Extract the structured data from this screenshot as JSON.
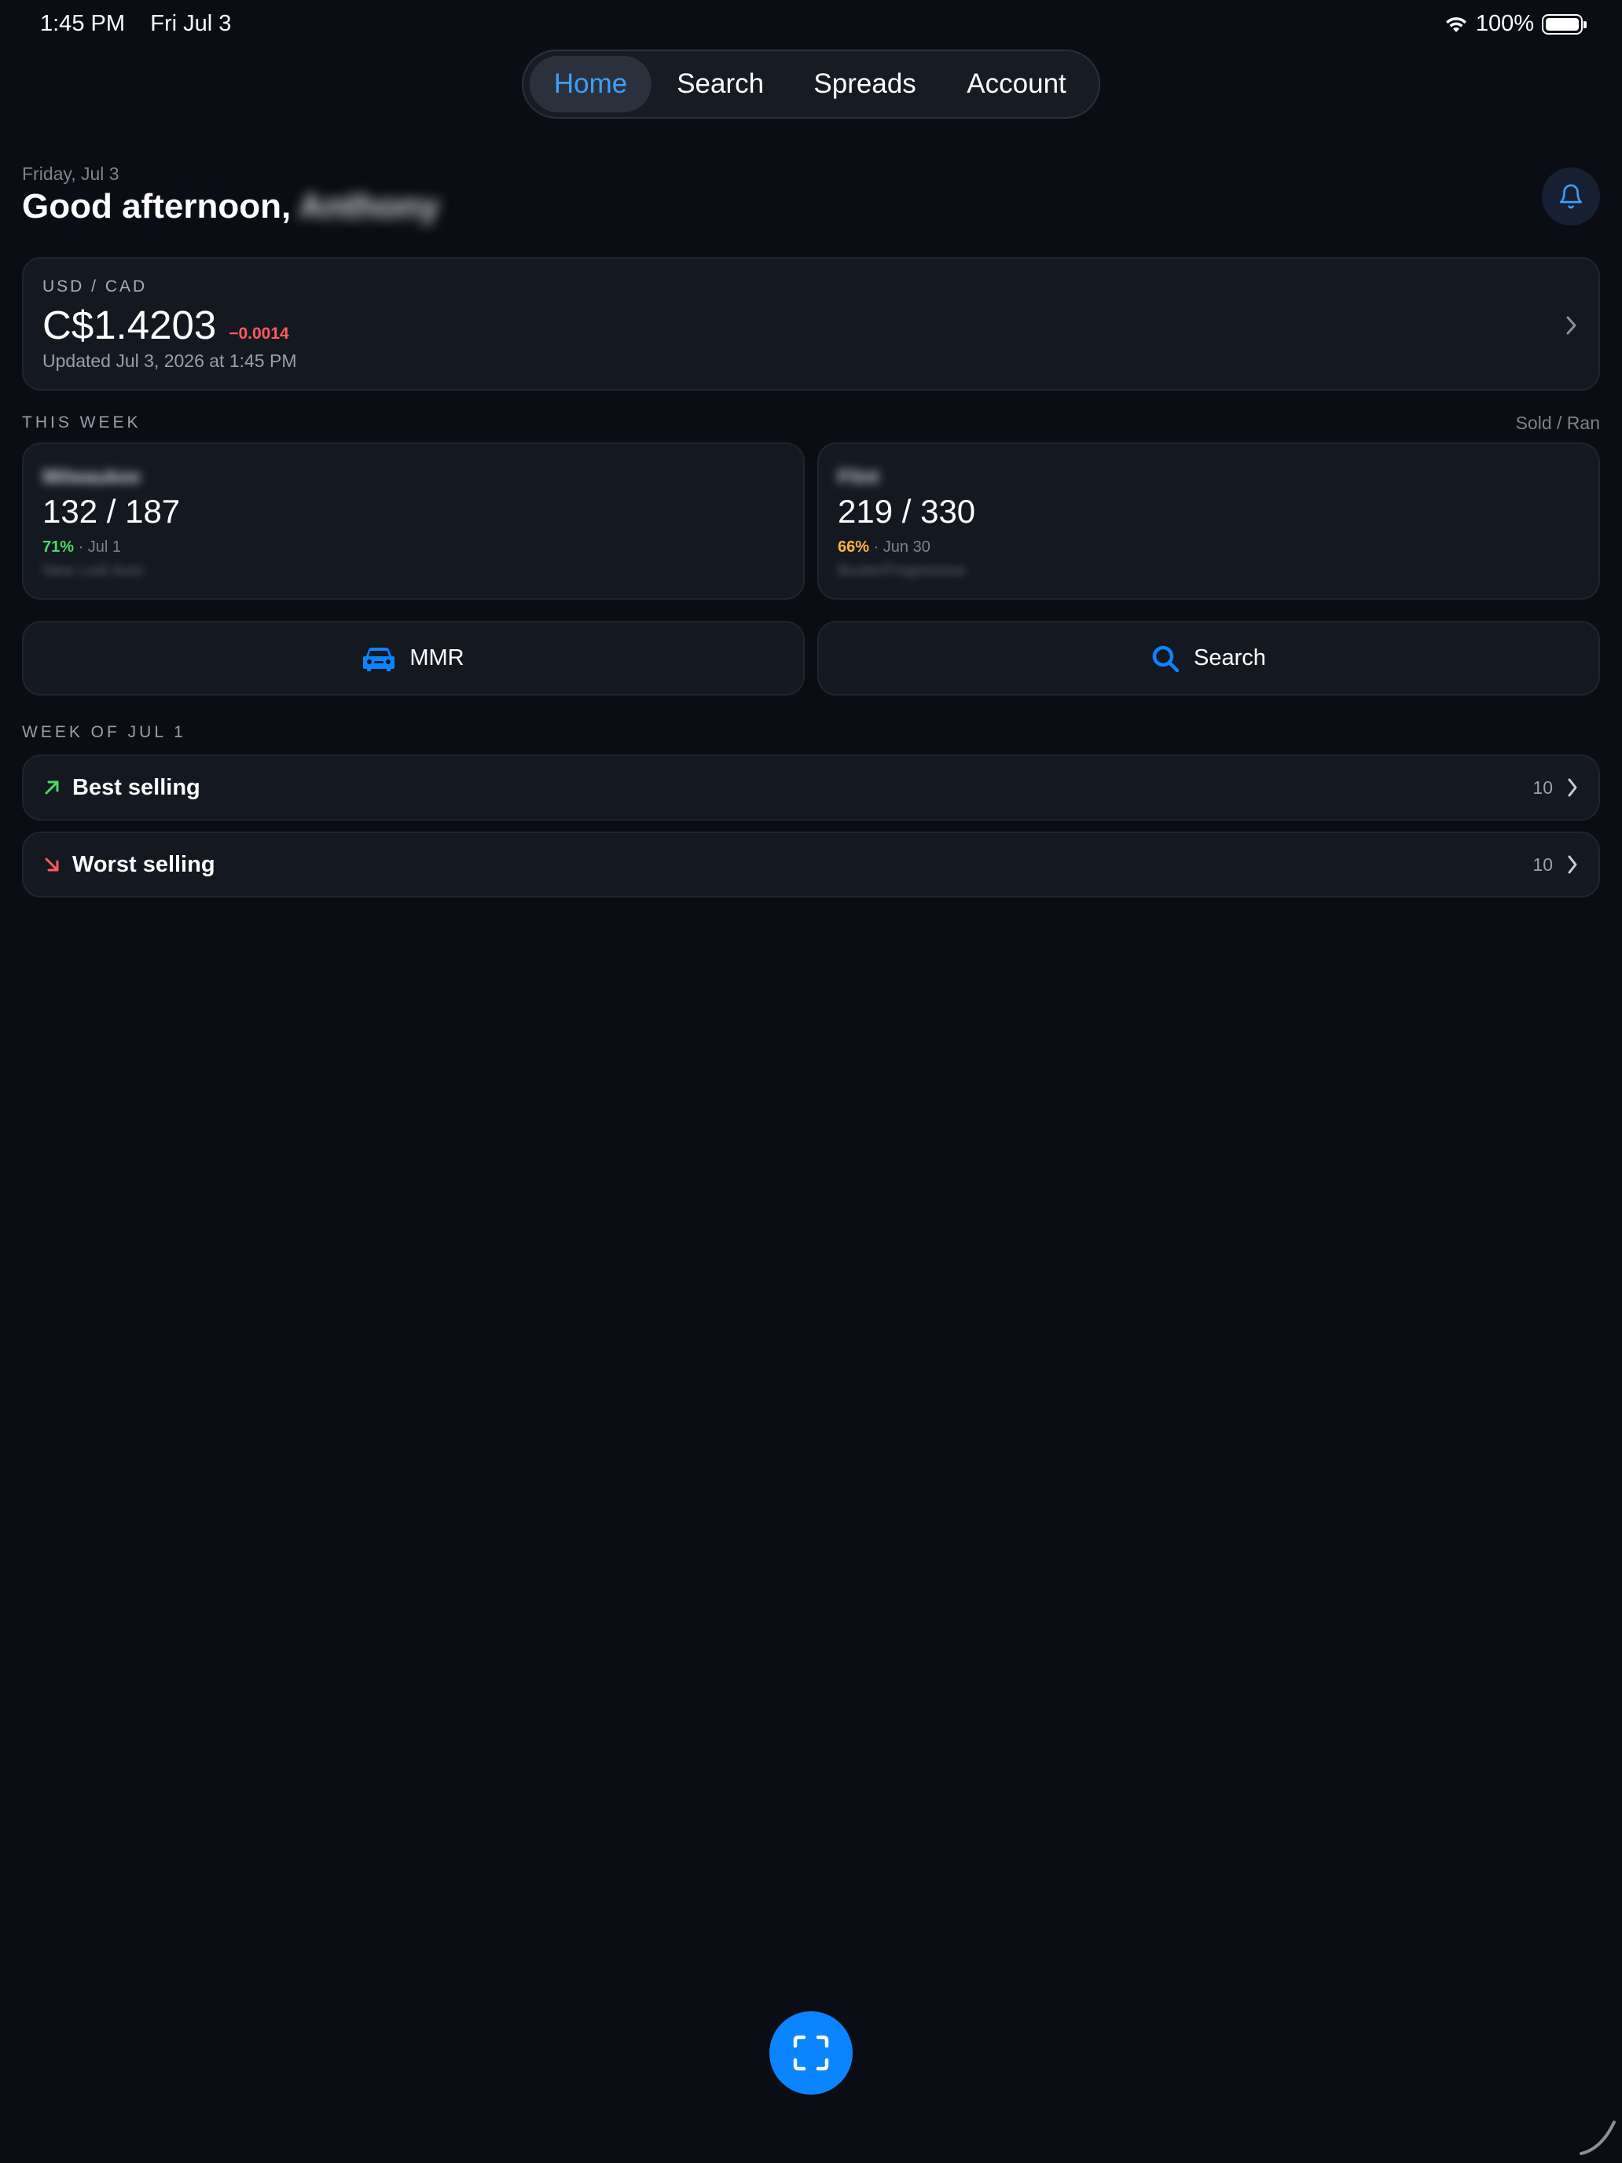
{
  "status_bar": {
    "time": "1:45 PM",
    "date": "Fri Jul 3",
    "battery": "100%"
  },
  "nav": {
    "tabs": [
      {
        "label": "Home",
        "active": true
      },
      {
        "label": "Search",
        "active": false
      },
      {
        "label": "Spreads",
        "active": false
      },
      {
        "label": "Account",
        "active": false
      }
    ]
  },
  "header": {
    "date": "Friday, Jul 3",
    "greeting": "Good afternoon,",
    "user_name": "Anthony"
  },
  "fx": {
    "pair": "USD / CAD",
    "rate": "C$1.4203",
    "change": "−0.0014",
    "updated": "Updated Jul 3, 2026 at 1:45 PM"
  },
  "this_week": {
    "label": "THIS WEEK",
    "legend": "Sold / Ran",
    "cards": [
      {
        "name": "Milwaukee",
        "count": "132 / 187",
        "pct": "71%",
        "date": "· Jul 1",
        "sub": "New Lodi Auto"
      },
      {
        "name": "Flint",
        "count": "219 / 330",
        "pct": "66%",
        "date": "· Jun 30",
        "sub": "BusterProgressive"
      }
    ]
  },
  "actions": {
    "mmr": "MMR",
    "search": "Search"
  },
  "week_of": {
    "label": "WEEK OF JUL 1",
    "rows": [
      {
        "label": "Best selling",
        "count": "10"
      },
      {
        "label": "Worst selling",
        "count": "10"
      }
    ]
  },
  "colors": {
    "accent": "#0b84ff",
    "positive": "#4cd964",
    "negative": "#ff5b5b",
    "warning": "#ffb340"
  }
}
